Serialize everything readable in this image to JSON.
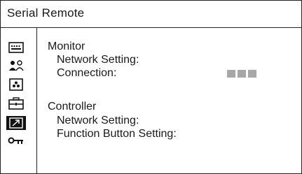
{
  "window": {
    "title": "Serial Remote"
  },
  "sidebar": {
    "items": [
      {
        "icon": "keyboard-icon",
        "active": false
      },
      {
        "icon": "users-icon",
        "active": false
      },
      {
        "icon": "camera-lens-icon",
        "active": false
      },
      {
        "icon": "toolbox-icon",
        "active": false
      },
      {
        "icon": "remote-arrow-icon",
        "active": true
      },
      {
        "icon": "key-icon",
        "active": false
      }
    ]
  },
  "sections": {
    "monitor": {
      "title": "Monitor",
      "network_setting_label": "Network Setting:",
      "connection_label": "Connection:",
      "connection_value": "■■■"
    },
    "controller": {
      "title": "Controller",
      "network_setting_label": "Network Setting:",
      "function_button_label": "Function Button Setting:"
    }
  },
  "colors": {
    "border": "#222222",
    "indicator": "#a7a7a7",
    "active_icon_bg": "#111111"
  }
}
